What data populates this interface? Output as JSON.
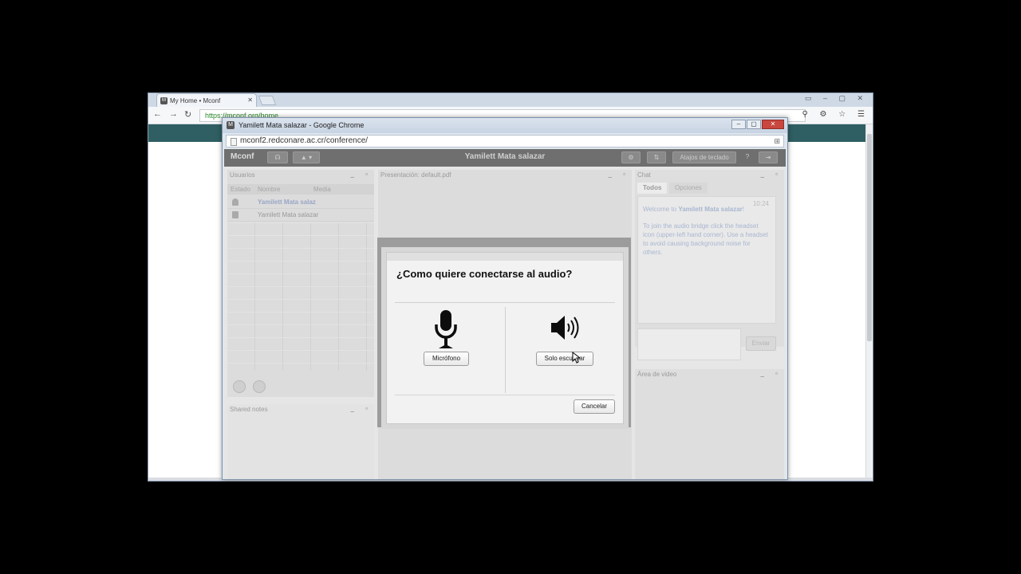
{
  "outer_window": {
    "tab_title": "My Home • Mconf",
    "url": "https://mconf.org/home"
  },
  "popup_window": {
    "title": "Yamilett Mata salazar - Google Chrome",
    "url": "mconf2.redconare.ac.cr/conference/"
  },
  "app": {
    "logo": "Mconf",
    "meeting_title": "Yamilett Mata salazar",
    "shortcuts_label": "Atajos de teclado",
    "help_label": "?",
    "users": {
      "title": "Usuarios",
      "columns": [
        "Estado",
        "Nombre",
        "Media"
      ],
      "rows": [
        {
          "name": "Yamilett Mata salaz"
        },
        {
          "name": "Yamilett Mata salazar"
        }
      ]
    },
    "shared_notes_title": "Shared notes",
    "presentation_title": "Presentación: default.pdf",
    "chat": {
      "title": "Chat",
      "tabs": [
        "Todos",
        "Opciones"
      ],
      "time": "10:24",
      "welcome_prefix": "Welcome to ",
      "welcome_name": "Yamilett Mata salazar",
      "welcome_suffix": "!",
      "message": "To join the audio bridge click the headset icon (upper-left hand corner). Use a headset to avoid causing background noise for others.",
      "send_label": "Enviar"
    },
    "video_area_title": "Área de video"
  },
  "modal": {
    "title": "¿Como quiere conectarse al audio?",
    "microphone_label": "Micrófono",
    "listen_only_label": "Solo escuchar",
    "cancel_label": "Cancelar"
  }
}
